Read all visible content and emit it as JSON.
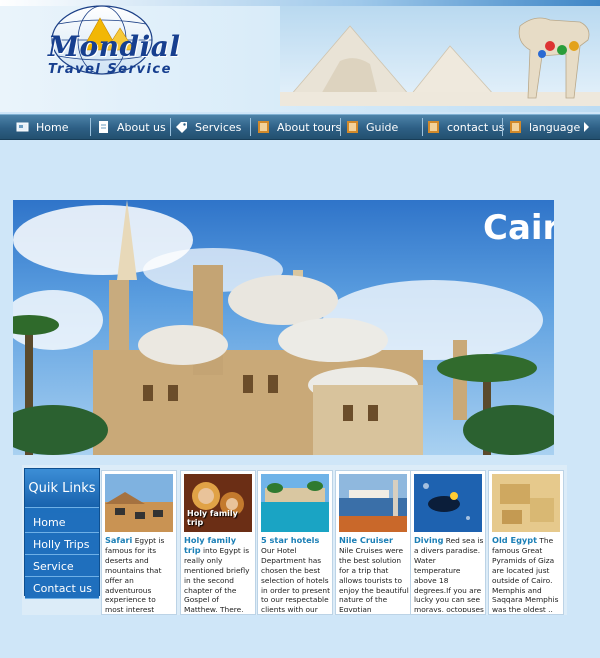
{
  "header": {
    "logo_title": "Mondial",
    "logo_subtitle": "Travel Service"
  },
  "nav": {
    "items": [
      {
        "label": "Home",
        "icon": "home-icon"
      },
      {
        "label": "About us",
        "icon": "document-icon"
      },
      {
        "label": "Services",
        "icon": "tag-icon"
      },
      {
        "label": "About tours",
        "icon": "film-icon"
      },
      {
        "label": "Guide",
        "icon": "film-icon"
      },
      {
        "label": "contact us",
        "icon": "film-icon"
      },
      {
        "label": "language",
        "icon": "film-icon"
      }
    ]
  },
  "hero": {
    "title": "Cair"
  },
  "quick_links": {
    "title": "Quik Links",
    "items": [
      "Home",
      "Holly Trips",
      "Service",
      "Contact us"
    ]
  },
  "cards": [
    {
      "title": "Safari",
      "text": "Egypt is famous for its deserts and mountains that offer an adventurous experience to most interest locals..."
    },
    {
      "title": "Holy family trip",
      "text": "into Egypt is really only mentioned briefly in the second chapter of the Gospel of Matthew. There, we learn that.",
      "image_label": "Holy family trip"
    },
    {
      "title": "5 star hotels",
      "text": "Our Hotel Department has chosen the best selection of hotels in order to present to our respectable clients with our very special prices"
    },
    {
      "title": "Nile Cruiser",
      "text": "Nile Cruises were the best solution for a trip that allows tourists to enjoy the beautiful nature of the Egyptian countryside.."
    },
    {
      "title": "Diving",
      "text": "Red sea is a divers paradise. Water temperature above 18 degrees.If you are lucky you can see morays, octopuses & sting rays"
    },
    {
      "title": "Old Egypt",
      "text": "The famous Great Pyramids of Giza are located just outside of Cairo. Memphis and Saqqara Memphis was the oldest .."
    }
  ],
  "colors": {
    "page_background": "#cfe6f8",
    "nav_bar": "#2d5f85",
    "logo_blue": "#173f8f",
    "quick_links_blue": "#1e6fbd",
    "card_title": "#1b7fb6"
  }
}
